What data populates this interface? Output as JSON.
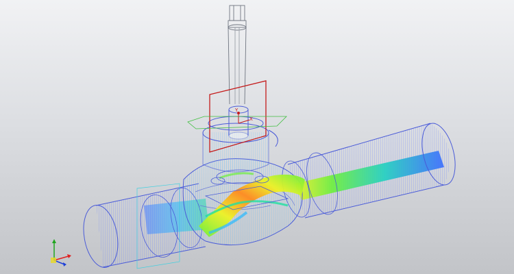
{
  "viewport": {
    "background_top": "#f1f2f4",
    "background_bottom": "#c2c4c8"
  },
  "model": {
    "outline_color": "#4a5bd8",
    "stem_outline_color": "#6f7580",
    "section_plane_color": "#c41a1a",
    "local_axis_labels": {
      "x": "X",
      "y": "Y"
    }
  },
  "flow": {
    "colormap": [
      "#3a4cff",
      "#27b9ff",
      "#20e0a0",
      "#6cf03a",
      "#eef224",
      "#ff8a1e",
      "#ff2a14"
    ]
  },
  "triad": {
    "x_color": "#e02020",
    "y_color": "#1fa51f",
    "z_color": "#1d3fd8",
    "icon": "coordinate-triad-icon"
  }
}
